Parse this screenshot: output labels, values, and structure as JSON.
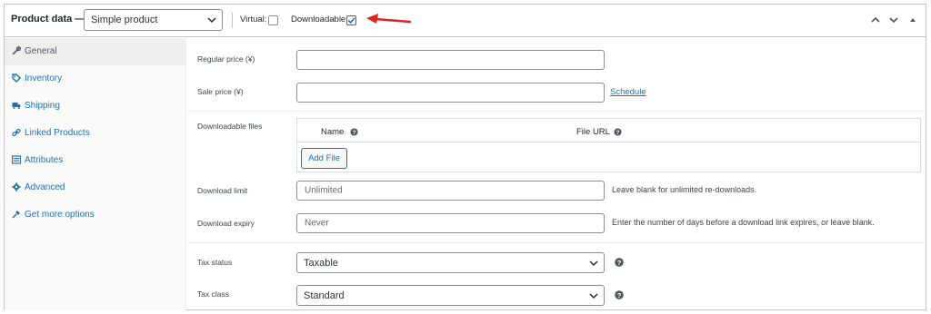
{
  "header": {
    "title": "Product data —",
    "product_type": "Simple product",
    "virtual_label": "Virtual:",
    "downloadable_label": "Downloadable:",
    "virtual_checked": false,
    "downloadable_checked": true
  },
  "sidebar": {
    "items": [
      {
        "label": "General",
        "icon": "wrench-icon",
        "active": true
      },
      {
        "label": "Inventory",
        "icon": "tag-icon"
      },
      {
        "label": "Shipping",
        "icon": "truck-icon"
      },
      {
        "label": "Linked Products",
        "icon": "link-icon"
      },
      {
        "label": "Attributes",
        "icon": "list-icon"
      },
      {
        "label": "Advanced",
        "icon": "gear-icon"
      },
      {
        "label": "Get more options",
        "icon": "plugin-icon"
      }
    ]
  },
  "general": {
    "regular_price_label": "Regular price (¥)",
    "sale_price_label": "Sale price (¥)",
    "schedule_link": "Schedule",
    "downloadable_files_label": "Downloadable files",
    "col_name": "Name",
    "col_file_url": "File URL",
    "add_file_button": "Add File",
    "download_limit_label": "Download limit",
    "download_limit_placeholder": "Unlimited",
    "download_limit_desc": "Leave blank for unlimited re-downloads.",
    "download_expiry_label": "Download expiry",
    "download_expiry_placeholder": "Never",
    "download_expiry_desc": "Enter the number of days before a download link expires, or leave blank.",
    "tax_status_label": "Tax status",
    "tax_status_value": "Taxable",
    "tax_class_label": "Tax class",
    "tax_class_value": "Standard"
  },
  "colors": {
    "accent": "#2271b1",
    "annotation_arrow": "#e02424"
  }
}
